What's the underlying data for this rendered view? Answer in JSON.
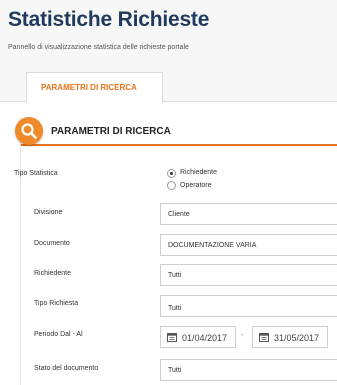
{
  "header": {
    "title": "Statistiche Richieste",
    "subtitle": "Pannello di visualizzazione statistica delle richieste portale"
  },
  "tabs": [
    {
      "label": "PARAMETRI DI RICERCA",
      "active": true
    }
  ],
  "panel": {
    "title": "PARAMETRI DI RICERCA",
    "icon": "search-icon",
    "accent_color": "#e8731c"
  },
  "form": {
    "tipo_statistica": {
      "label": "Tipo Statistica",
      "options": [
        {
          "label": "Richiedente",
          "checked": true
        },
        {
          "label": "Operatore",
          "checked": false
        }
      ]
    },
    "divisione": {
      "label": "Divisione",
      "value": "Cliente"
    },
    "documento": {
      "label": "Documento",
      "value": "DOCUMENTAZIONE VARIA"
    },
    "richiedente": {
      "label": "Richiedente",
      "value": "Tutti"
    },
    "tipo_richiesta": {
      "label": "Tipo Richiesta",
      "value": "Tutti"
    },
    "periodo": {
      "label": "Periodo Dal - Al",
      "from": "01/04/2017",
      "separator": "-",
      "to": "31/05/2017",
      "icon": "calendar-icon"
    },
    "stato_documento": {
      "label": "Stato del documento",
      "value": "Tutti"
    }
  }
}
